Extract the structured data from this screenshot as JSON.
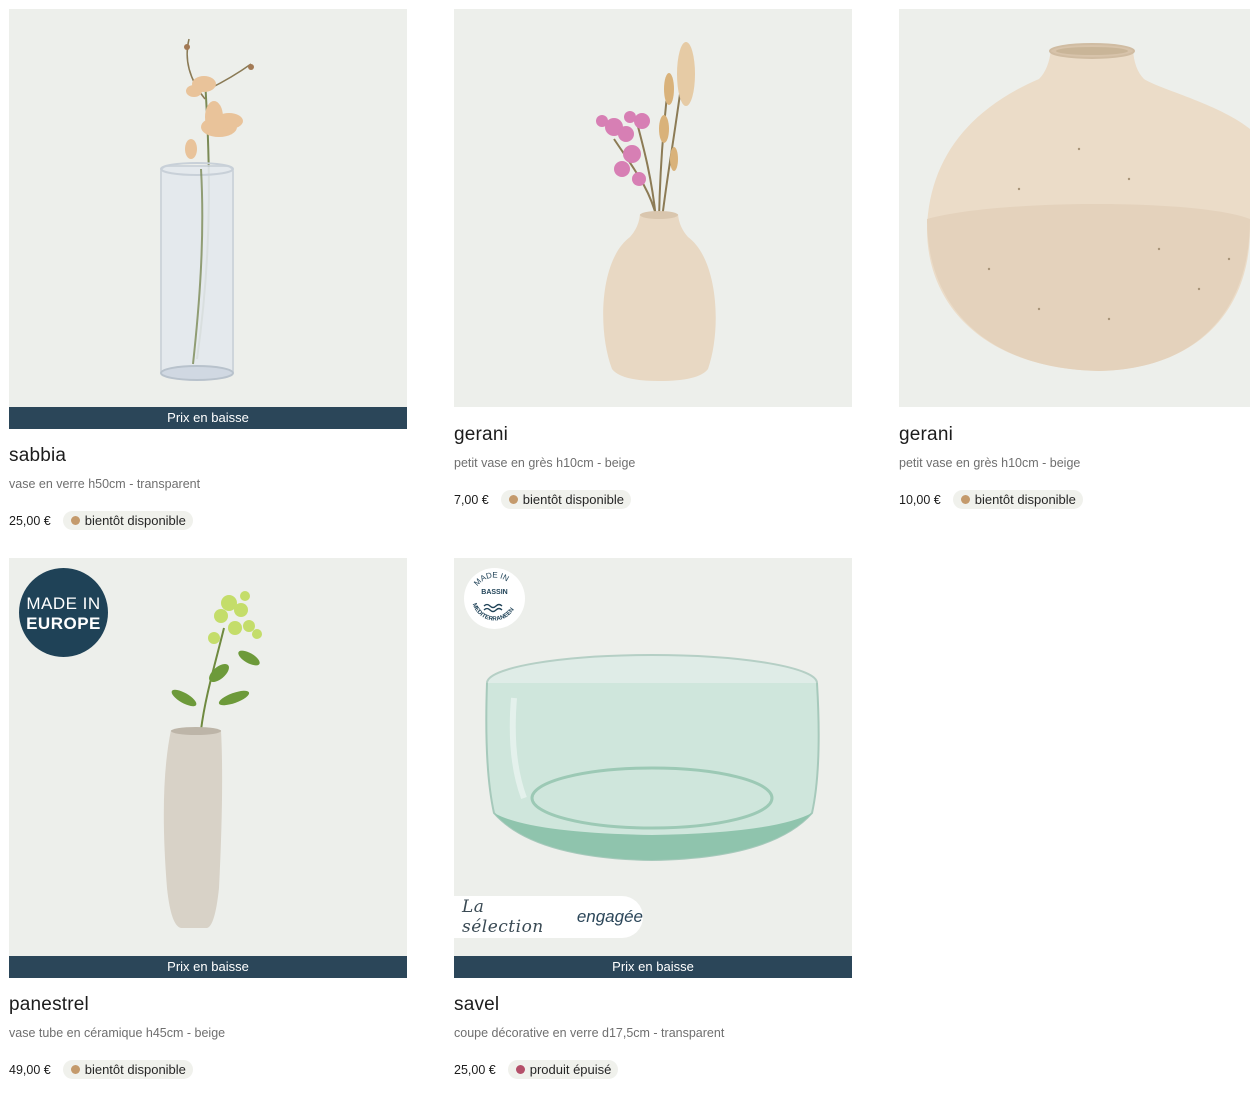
{
  "colors": {
    "banner_bg": "#2b4659",
    "image_bg": "#edefeb",
    "dot_soon": "#c49a6c",
    "dot_soldout": "#b4506a"
  },
  "products": [
    {
      "banner": "Prix en baisse",
      "name": "sabbia",
      "desc": "vase en verre h50cm - transparent",
      "price": "25,00 €",
      "status": "bientôt disponible"
    },
    {
      "name": "gerani",
      "desc": "petit vase en grès h10cm - beige",
      "price": "7,00 €",
      "status": "bientôt disponible"
    },
    {
      "name": "gerani",
      "desc": "petit vase en grès h10cm - beige",
      "price": "10,00 €",
      "status": "bientôt disponible"
    },
    {
      "badge_line1": "MADE IN",
      "badge_line2": "EUROPE",
      "banner": "Prix en baisse",
      "name": "panestrel",
      "desc": "vase tube en céramique h45cm - beige",
      "price": "49,00 €",
      "status": "bientôt disponible"
    },
    {
      "seal_top": "MADE IN",
      "seal_mid": "BASSIN",
      "seal_bottom": "MEDITERRANEEN",
      "tag_script": "La sélection",
      "tag_bold": "engagée",
      "banner": "Prix en baisse",
      "name": "savel",
      "desc": "coupe décorative en verre d17,5cm - transparent",
      "price": "25,00 €",
      "status": "produit épuisé"
    }
  ]
}
